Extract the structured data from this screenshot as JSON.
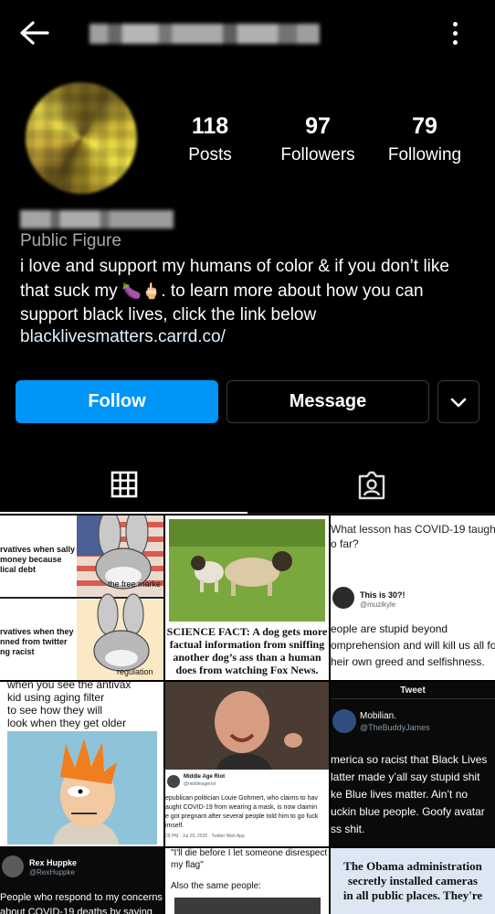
{
  "header": {
    "back_icon": "arrow-left-icon",
    "menu_icon": "kebab-icon"
  },
  "profile": {
    "stats": {
      "posts": {
        "value": "118",
        "label": "Posts"
      },
      "followers": {
        "value": "97",
        "label": "Followers"
      },
      "following": {
        "value": "79",
        "label": "Following"
      }
    },
    "category": "Public Figure",
    "bio_line1": "i love and support my humans of color & if you don’t like",
    "bio_line2_pre": "that suck my ",
    "bio_emoji": "🍆🖕🏻",
    "bio_line2_post": ". to learn more about how you can",
    "bio_line3": "support black lives, click the link below",
    "link": "blacklivesmatters.carrd.co/"
  },
  "actions": {
    "follow": "Follow",
    "message": "Message",
    "more_icon": "chevron-down-icon"
  },
  "tabs": [
    {
      "name": "grid",
      "icon": "grid-icon",
      "selected": true
    },
    {
      "name": "tagged",
      "icon": "tagged-person-icon",
      "selected": false
    }
  ],
  "posts": {
    "p1": {
      "cap_a1": "rvatives when sally",
      "cap_a2": "money because",
      "cap_a3": "lical debt",
      "cap_a4": "the free marke",
      "cap_b1": "rvatives when they",
      "cap_b2": "nned from twitter",
      "cap_b3": "ng racist",
      "cap_b4": "regulation"
    },
    "p2": {
      "line1": "SCIENCE FACT: A dog gets more",
      "line2": "factual information from sniffing",
      "line3": "another dog’s ass than a human",
      "line4": "does from watching Fox News."
    },
    "p3": {
      "q1": "What lesson has COVID-19 taught u",
      "q2": "o far?",
      "name": "This is 30?!",
      "handle": "@muzikyle",
      "a1": "eople are stupid beyond",
      "a2": "omprehension and will kill us all for",
      "a3": "heir own greed and selfishness."
    },
    "p4": {
      "l1": "when you see the antivax",
      "l2": "kid using aging filter",
      "l3": "to see how they will",
      "l4": "look when they get older"
    },
    "p5": {
      "src": "Middle Age Riot",
      "handle": "@middleageriot",
      "t1": "epublican politician Louie Gohmert, who claims to hav",
      "t2": "aught COVID-19 from wearing a mask, is now claimin",
      "t3": "e got pregnant after several people told him to go fuck",
      "t4": "imself.",
      "time": "29 PM · Jul 20, 2020 · Twitter Web App"
    },
    "p6": {
      "header": "Tweet",
      "name": "Mobilian.",
      "handle": "@TheBuddyJames",
      "t1": "merica so racist that Black Lives",
      "t2": "latter made y’all say stupid shit",
      "t3": "ke Blue lives matter. Ain’t no",
      "t4": "uckin blue people. Goofy avatar",
      "t5": "ss shit."
    },
    "p7": {
      "name": "Rex Huppke",
      "handle": "@RexHuppke",
      "t1": "People who respond to my concerns",
      "t2": "about COVID-19 deaths by saying"
    },
    "p8": {
      "q1": "\"I'll die before I let someone disrespect",
      "q2": "my flag\"",
      "a1": "Also the same people:"
    },
    "p9": {
      "l1": "The Obama administration",
      "l2": "secretly installed cameras",
      "l3": "in all public places. They're"
    }
  }
}
